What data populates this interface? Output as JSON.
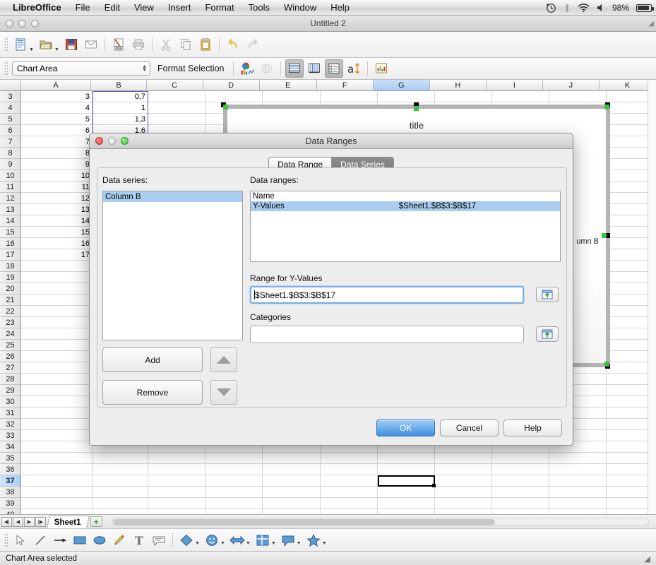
{
  "menubar": {
    "app": "LibreOffice",
    "items": [
      "File",
      "Edit",
      "View",
      "Insert",
      "Format",
      "Tools",
      "Window",
      "Help"
    ],
    "status": {
      "timemachine_icon": "time-machine-icon",
      "bluetooth_icon": "bluetooth-icon",
      "wifi_icon": "wifi-icon",
      "volume_icon": "volume-icon",
      "battery_percent": "98%",
      "battery_icon": "battery-icon"
    }
  },
  "window": {
    "title": "Untitled 2"
  },
  "toolbar_main": {
    "buttons": [
      {
        "name": "new-document",
        "glyph": "📄",
        "dropdown": true
      },
      {
        "name": "open-document",
        "glyph": "📁",
        "dropdown": true
      },
      {
        "name": "save-document",
        "glyph": "💾",
        "dropdown": false
      },
      {
        "name": "email-document",
        "glyph": "✉",
        "dropdown": false
      },
      {
        "name": "export-pdf",
        "glyph": "PDF",
        "dropdown": false
      },
      {
        "name": "print-document",
        "glyph": "🖨",
        "dropdown": false
      },
      {
        "name": "cut",
        "glyph": "✂",
        "dropdown": false
      },
      {
        "name": "copy",
        "glyph": "⧉",
        "dropdown": false
      },
      {
        "name": "paste",
        "glyph": "📋",
        "dropdown": false
      },
      {
        "name": "undo",
        "glyph": "↶",
        "dropdown": false
      },
      {
        "name": "redo",
        "glyph": "↷",
        "dropdown": false
      }
    ]
  },
  "toolbar_chart": {
    "selection_combo": "Chart Area",
    "format_selection_label": "Format Selection",
    "buttons": [
      {
        "name": "chart-type",
        "glyph": "◕",
        "state": "normal"
      },
      {
        "name": "3d-view",
        "glyph": "⧉",
        "state": "disabled"
      },
      {
        "name": "horizontal-grids",
        "glyph": "☰",
        "state": "pressed"
      },
      {
        "name": "vertical-grids",
        "glyph": "⦀",
        "state": "normal"
      },
      {
        "name": "legend-on-off",
        "glyph": "≣",
        "state": "pressed"
      },
      {
        "name": "scale-text",
        "glyph": "a↕",
        "state": "normal"
      },
      {
        "name": "data-table",
        "glyph": "▦",
        "state": "normal"
      }
    ]
  },
  "spreadsheet": {
    "columns": [
      "A",
      "B",
      "C",
      "D",
      "E",
      "F",
      "G",
      "H",
      "I",
      "J",
      "K"
    ],
    "selected_column": "G",
    "selected_row": "37",
    "first_row": 3,
    "last_row": 40,
    "cells": {
      "A": {
        "3": "3",
        "4": "4",
        "5": "5",
        "6": "6",
        "7": "7",
        "8": "8",
        "9": "9",
        "10": "10",
        "11": "11",
        "12": "12",
        "13": "13",
        "14": "14",
        "15": "15",
        "16": "16",
        "17": "17"
      },
      "B": {
        "3": "0,7",
        "4": "1",
        "5": "1,3",
        "6": "1,6"
      }
    },
    "active_cell": "G37"
  },
  "chart_object": {
    "title": "title",
    "legend_label": "umn B",
    "legend_full": "Column B",
    "state": "edit-mode-selected"
  },
  "dialog": {
    "title": "Data Ranges",
    "tabs": [
      {
        "label": "Data Range",
        "active": false
      },
      {
        "label": "Data Series",
        "active": true
      }
    ],
    "data_series_label": "Data series:",
    "data_series_items": [
      {
        "label": "Column B",
        "selected": true
      }
    ],
    "data_ranges_label": "Data ranges:",
    "data_ranges_rows": [
      {
        "name": "Name",
        "value": "",
        "selected": false
      },
      {
        "name": "Y-Values",
        "value": "$Sheet1.$B$3:$B$17",
        "selected": true
      }
    ],
    "range_y_label": "Range for Y-Values",
    "range_y_value": "$Sheet1.$B$3:$B$17",
    "range_y_shrink_icon": "shrink-range-icon",
    "categories_label": "Categories",
    "categories_value": "",
    "categories_placeholder": "",
    "categories_shrink_icon": "shrink-range-icon",
    "add_label": "Add",
    "remove_label": "Remove",
    "move_up_icon": "triangle-up-icon",
    "move_down_icon": "triangle-down-icon",
    "ok_label": "OK",
    "cancel_label": "Cancel",
    "help_label": "Help"
  },
  "sheet_tabs": {
    "nav": [
      "first-sheet",
      "previous-sheet",
      "next-sheet",
      "last-sheet"
    ],
    "tabs": [
      {
        "label": "Sheet1",
        "active": true
      }
    ],
    "add_sheet_glyph": "+"
  },
  "drawing_toolbar": {
    "tools": [
      {
        "name": "select-tool",
        "glyph": "➤",
        "dropdown": false
      },
      {
        "name": "line-tool",
        "glyph": "╱",
        "dropdown": false
      },
      {
        "name": "arrow-tool",
        "glyph": "→",
        "dropdown": false
      },
      {
        "name": "rectangle-tool",
        "glyph": "▬",
        "dropdown": false
      },
      {
        "name": "ellipse-tool",
        "glyph": "⬬",
        "dropdown": false
      },
      {
        "name": "freeform-line-tool",
        "glyph": "✎",
        "dropdown": false
      },
      {
        "name": "text-box-tool",
        "glyph": "T",
        "dropdown": false
      },
      {
        "name": "callout-tool",
        "glyph": "💬",
        "dropdown": false
      },
      {
        "name": "basic-shapes-tool",
        "glyph": "◆",
        "dropdown": true
      },
      {
        "name": "symbol-shapes-tool",
        "glyph": "☺",
        "dropdown": true
      },
      {
        "name": "block-arrows-tool",
        "glyph": "↔",
        "dropdown": true
      },
      {
        "name": "flowchart-tool",
        "glyph": "▥",
        "dropdown": true
      },
      {
        "name": "callouts-tool",
        "glyph": "🗨",
        "dropdown": true
      },
      {
        "name": "stars-tool",
        "glyph": "★",
        "dropdown": true
      }
    ]
  },
  "statusbar": {
    "text": "Chart Area selected"
  }
}
